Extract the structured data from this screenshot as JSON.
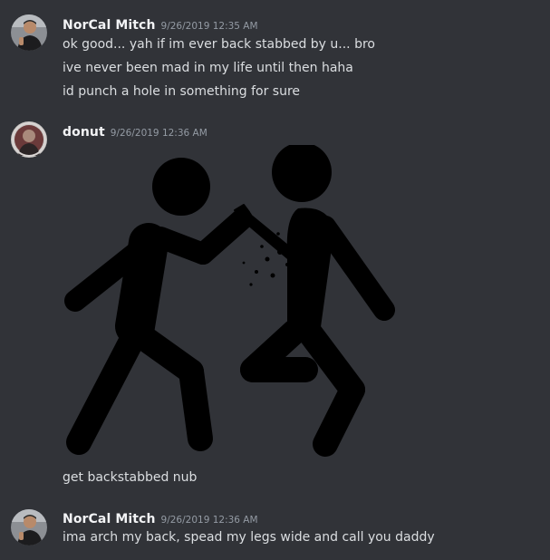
{
  "messages": [
    {
      "username": "NorCal Mitch",
      "timestamp": "9/26/2019 12:35 AM",
      "lines": [
        "ok good... yah if im ever back stabbed by u... bro",
        "ive never been mad in my life until then haha",
        "id punch a hole in something for sure"
      ]
    },
    {
      "username": "donut",
      "timestamp": "9/26/2019 12:36 AM",
      "attachment": "backstab-stick-figures-image",
      "lines": [
        "get backstabbed nub"
      ]
    },
    {
      "username": "NorCal Mitch",
      "timestamp": "9/26/2019 12:36 AM",
      "lines": [
        "ima arch my back, spead my legs wide and call you daddy"
      ]
    }
  ],
  "colors": {
    "background": "#313338",
    "username": "#f2f3f5",
    "timestamp": "#949ba4",
    "text": "#dbdee1"
  }
}
